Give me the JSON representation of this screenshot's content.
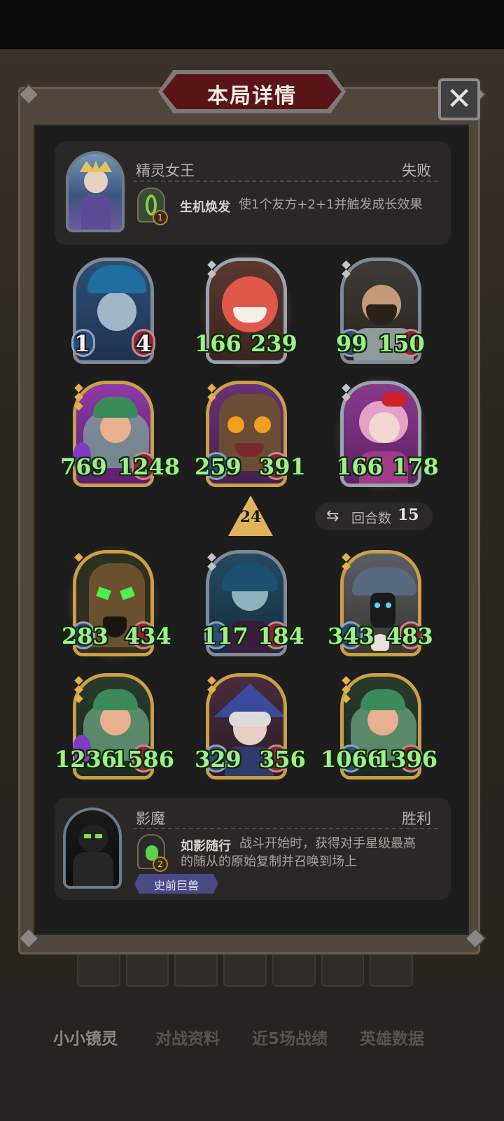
{
  "title": "本局详情",
  "close_icon": "close-icon",
  "player_top": {
    "name": "精灵女王",
    "result": "失败",
    "skill_level": "1",
    "skill_name": "生机焕发",
    "skill_desc": "使1个友方+2+1并触发成长效果"
  },
  "player_bottom": {
    "name": "影魔",
    "result": "胜利",
    "skill_level": "2",
    "skill_name": "如影随行",
    "skill_desc_line1": "战斗开始时，获得对手星级最高",
    "skill_desc_line2": "的随从的原始复制并召唤到场上",
    "tag": "史前巨兽"
  },
  "center": {
    "tier": "24",
    "rounds_label": "回合数",
    "rounds": "15",
    "rounds_icon": "swap-icon"
  },
  "top_board": [
    {
      "atk": "1",
      "hp": "4"
    },
    {
      "atk": "166",
      "hp": "239"
    },
    {
      "atk": "99",
      "hp": "150"
    },
    {
      "atk": "769",
      "hp": "1248"
    },
    {
      "atk": "259",
      "hp": "391"
    },
    {
      "atk": "166",
      "hp": "178"
    }
  ],
  "bottom_board": [
    {
      "atk": "283",
      "hp": "434"
    },
    {
      "atk": "117",
      "hp": "184"
    },
    {
      "atk": "343",
      "hp": "483"
    },
    {
      "atk": "1236",
      "hp": "1586"
    },
    {
      "atk": "329",
      "hp": "356"
    },
    {
      "atk": "1066",
      "hp": "1396"
    }
  ],
  "bottom_nav": [
    "小小镜灵",
    "对战资料",
    "近5场战绩",
    "英雄数据"
  ],
  "colors": {
    "panel": "#1d1d1d",
    "stat_green": "#9ef08a",
    "title_red": "#5a1418",
    "gold_frame": "#c9a046",
    "silver_frame": "#7f8a96"
  }
}
